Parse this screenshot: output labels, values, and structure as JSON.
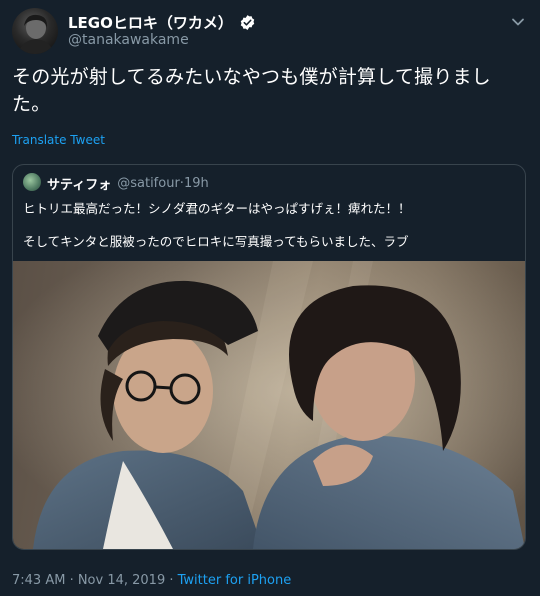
{
  "author": {
    "display_name": "LEGOヒロキ（ワカメ）",
    "handle": "@tanakawakame",
    "verified": true
  },
  "tweet": {
    "text_line1": "その光が射してるみたいなやつも僕が計算して撮りまし",
    "text_line2": "た。",
    "translate_label": "Translate Tweet"
  },
  "quoted": {
    "display_name": "サティフォ",
    "handle": "@satifour",
    "separator": " · ",
    "time": "19h",
    "line1": "ヒトリエ最高だった！シノダ君のギターはやっぱすげぇ！痺れた！！",
    "line2": "そしてキンタと服被ったのでヒロキに写真撮ってもらいました、ラブ"
  },
  "footer": {
    "timestamp": "7:43 AM · Nov 14, 2019",
    "separator": " · ",
    "source": "Twitter for iPhone"
  },
  "colors": {
    "background": "#15202b",
    "accent": "#1da1f2",
    "muted": "#8899a6",
    "border": "#38444d"
  },
  "icons": {
    "verified": "verified-badge-icon",
    "more": "chevron-down-icon"
  }
}
